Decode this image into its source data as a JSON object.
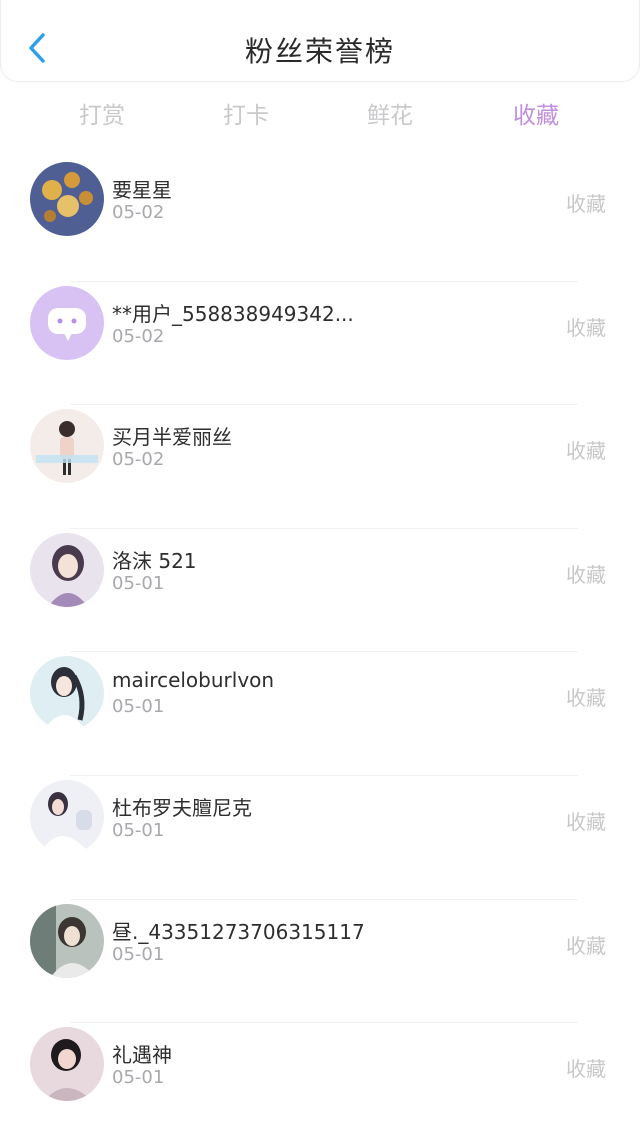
{
  "header": {
    "title": "粉丝荣誉榜",
    "back_icon": "chevron-left-icon"
  },
  "tabs": [
    {
      "label": "打赏",
      "active": false
    },
    {
      "label": "打卡",
      "active": false
    },
    {
      "label": "鲜花",
      "active": false
    },
    {
      "label": "收藏",
      "active": true
    }
  ],
  "colors": {
    "accent": "#c18fe0",
    "back": "#2b9fe8"
  },
  "fans": [
    {
      "name": "要星星",
      "date": "05-02",
      "action": "收藏",
      "avatar": "flowers-photo"
    },
    {
      "name": "**用户_558838949342...",
      "date": "05-02",
      "action": "收藏",
      "avatar": "default-chat-avatar"
    },
    {
      "name": "买月半爱丽丝",
      "date": "05-02",
      "action": "收藏",
      "avatar": "girl-photo"
    },
    {
      "name": "洛沫 521",
      "date": "05-01",
      "action": "收藏",
      "avatar": "anime-girl-photo"
    },
    {
      "name": "mairceloburlvon",
      "date": "05-01",
      "action": "收藏",
      "avatar": "anime-girl-photo"
    },
    {
      "name": "杜布罗夫膻尼克",
      "date": "05-01",
      "action": "收藏",
      "avatar": "girl-photo"
    },
    {
      "name": "昼._43351273706315117",
      "date": "05-01",
      "action": "收藏",
      "avatar": "anime-boy-photo"
    },
    {
      "name": "礼遇神",
      "date": "05-01",
      "action": "收藏",
      "avatar": "girl-photo"
    }
  ]
}
